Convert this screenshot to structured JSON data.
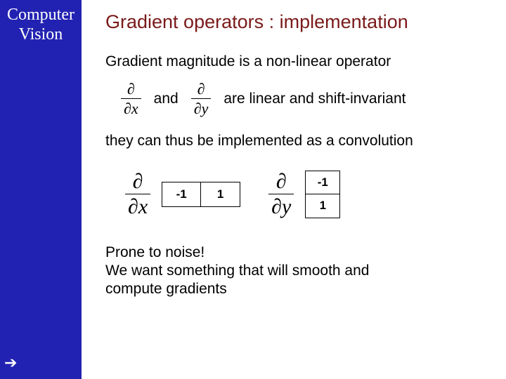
{
  "sidebar": {
    "title_line1": "Computer",
    "title_line2": "Vision"
  },
  "slide": {
    "title": "Gradient operators : implementation",
    "line_magnitude": "Gradient magnitude is a non-linear operator",
    "and_label": "and",
    "linear_label": "are linear and shift-invariant",
    "convolution_line": "they can thus be implemented as a convolution",
    "closing_line1": "Prone to noise!",
    "closing_line2": "We want something that will smooth and",
    "closing_line3": "compute gradients"
  },
  "math": {
    "dx_num": "∂",
    "dx_vars": "x",
    "dy_num": "∂",
    "dy_vars": "y",
    "d_sym": "∂"
  },
  "kernels": {
    "h": [
      "-1",
      "1"
    ],
    "v": [
      "-1",
      "1"
    ]
  }
}
